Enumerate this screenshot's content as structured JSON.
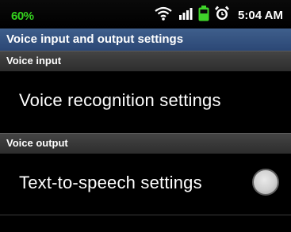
{
  "status_bar": {
    "battery_percent": "60%",
    "time": "5:04 AM",
    "icons": [
      "wifi-icon",
      "signal-icon",
      "battery-icon",
      "alarm-icon"
    ]
  },
  "screen": {
    "title": "Voice input and output settings"
  },
  "sections": {
    "voice_input": {
      "header": "Voice input",
      "item_label": "Voice recognition settings"
    },
    "voice_output": {
      "header": "Voice output",
      "item_label": "Text-to-speech settings",
      "radio_checked": false
    }
  },
  "colors": {
    "battery_text": "#34d11e",
    "title_bar": "#2f4d7c",
    "section_header": "#3a3a3a"
  }
}
